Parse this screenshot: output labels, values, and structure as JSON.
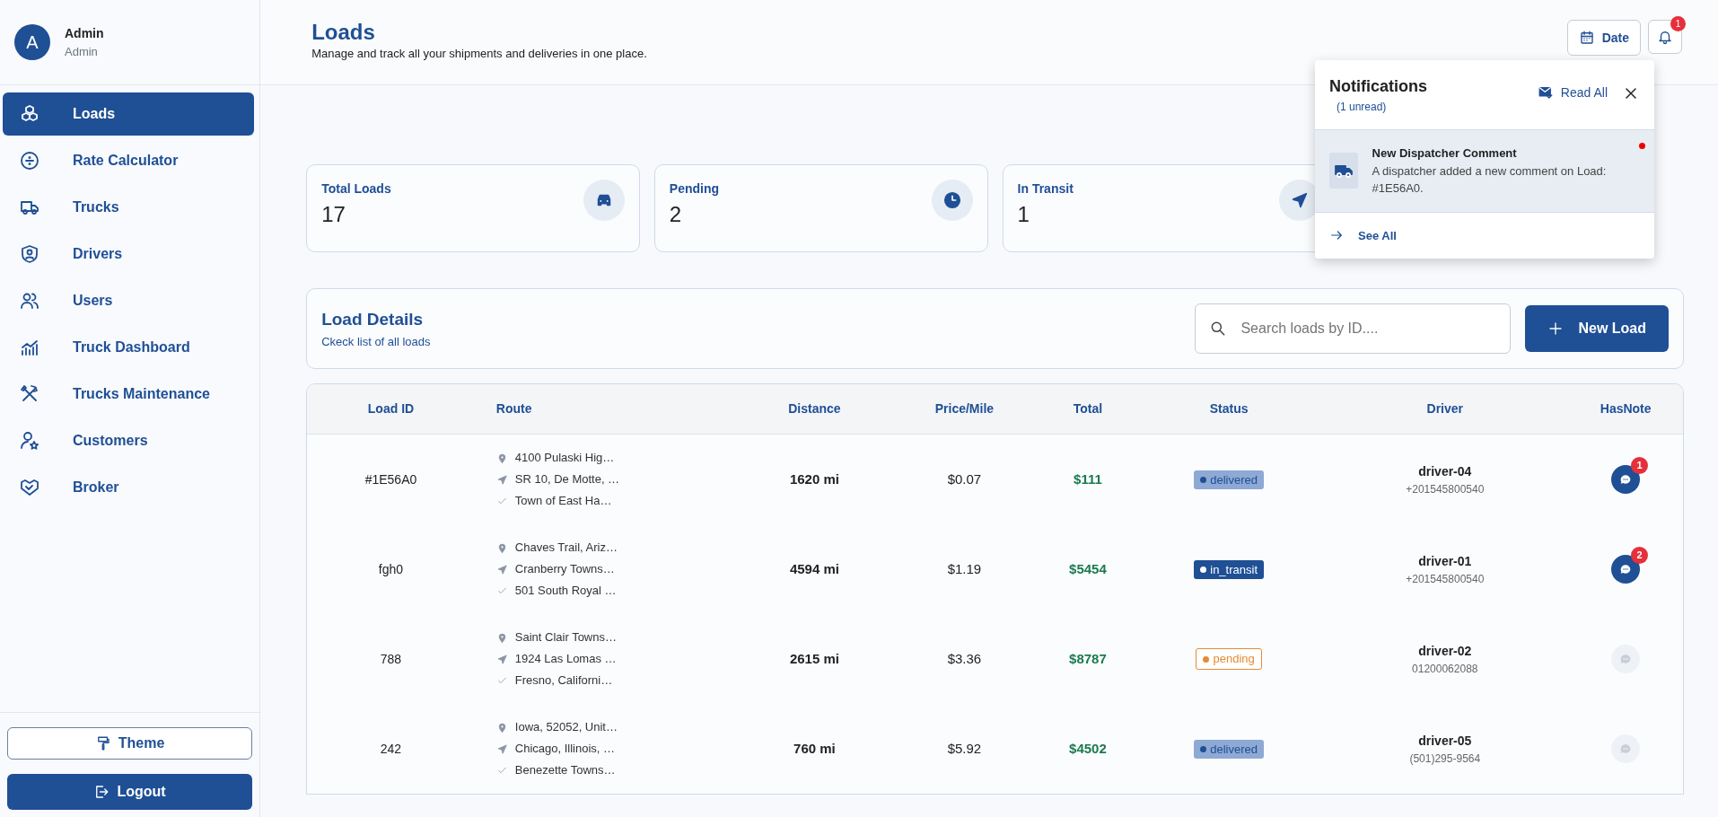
{
  "user": {
    "initial": "A",
    "name": "Admin",
    "role": "Admin"
  },
  "sidebar": {
    "items": [
      {
        "label": "Loads",
        "selected": true
      },
      {
        "label": "Rate Calculator",
        "selected": false
      },
      {
        "label": "Trucks",
        "selected": false
      },
      {
        "label": "Drivers",
        "selected": false
      },
      {
        "label": "Users",
        "selected": false
      },
      {
        "label": "Truck Dashboard",
        "selected": false
      },
      {
        "label": "Trucks Maintenance",
        "selected": false
      },
      {
        "label": "Customers",
        "selected": false
      },
      {
        "label": "Broker",
        "selected": false
      }
    ],
    "theme_button": "Theme",
    "logout_button": "Logout"
  },
  "header": {
    "title": "Loads",
    "subtitle": "Manage and track all your shipments and deliveries in one place.",
    "date_button": "Date",
    "notification_count": "1"
  },
  "stats": [
    {
      "label": "Total Loads",
      "value": "17"
    },
    {
      "label": "Pending",
      "value": "2"
    },
    {
      "label": "In Transit",
      "value": "1"
    }
  ],
  "notifications": {
    "title": "Notifications",
    "unread": "(1 unread)",
    "read_all": "Read All",
    "see_all": "See All",
    "items": [
      {
        "title": "New Dispatcher Comment",
        "message": "A dispatcher added a new comment on Load: #1E56A0.",
        "unread": true
      }
    ]
  },
  "load_details": {
    "title": "Load Details",
    "subtitle": "Ckeck list of all loads",
    "search": {
      "placeholder": "Search loads by ID...."
    },
    "new_button": "New Load"
  },
  "table": {
    "columns": [
      "Load ID",
      "Route",
      "Distance",
      "Price/Mile",
      "Total",
      "Status",
      "Driver",
      "HasNote"
    ],
    "rows": [
      {
        "load_id": "#1E56A0",
        "route": [
          "4100 Pulaski Hig…",
          "SR 10, De Motte, …",
          "Town of East Ha…"
        ],
        "distance": "1620 mi",
        "price_mile": "$0.07",
        "total": "$111",
        "status": {
          "kind": "delivered",
          "label": "delivered"
        },
        "driver": "driver-04",
        "phone": "+201545800540",
        "has_note": true,
        "note_count": "1"
      },
      {
        "load_id": "fgh0",
        "route": [
          "Chaves Trail, Ariz…",
          "Cranberry Towns…",
          "501 South Royal …"
        ],
        "distance": "4594 mi",
        "price_mile": "$1.19",
        "total": "$5454",
        "status": {
          "kind": "in_transit",
          "label": "in_transit"
        },
        "driver": "driver-01",
        "phone": "+201545800540",
        "has_note": true,
        "note_count": "2"
      },
      {
        "load_id": "788",
        "route": [
          "Saint Clair Towns…",
          "1924 Las Lomas …",
          "Fresno, Californi…"
        ],
        "distance": "2615 mi",
        "price_mile": "$3.36",
        "total": "$8787",
        "status": {
          "kind": "pending",
          "label": "pending"
        },
        "driver": "driver-02",
        "phone": "01200062088",
        "has_note": false
      },
      {
        "load_id": "242",
        "route": [
          "Iowa, 52052, Unit…",
          "Chicago, Illinois, …",
          "Benezette Towns…"
        ],
        "distance": "760 mi",
        "price_mile": "$5.92",
        "total": "$4502",
        "status": {
          "kind": "delivered",
          "label": "delivered"
        },
        "driver": "driver-05",
        "phone": "(501)295-9564",
        "has_note": false
      }
    ]
  }
}
